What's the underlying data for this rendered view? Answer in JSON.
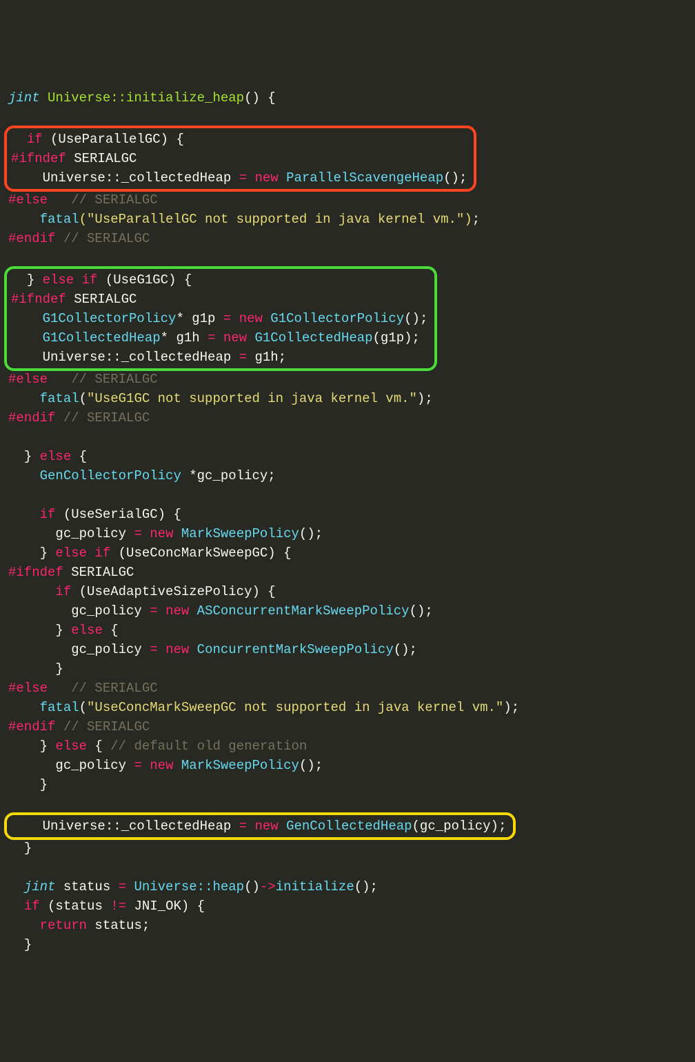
{
  "code": {
    "ret_type": "jint",
    "sig": "Universe::initialize_heap",
    "sig_tail": "() {",
    "if1": "if",
    "useParallel": "(UseParallelGC) {",
    "ifndef": "#ifndef",
    "serialgc": " SERIALGC",
    "assignPrefix": "Universe::_collectedHeap ",
    "eq": "= ",
    "new": "new",
    "psHeap": " ParallelScavengeHeap",
    "callTail0": "();",
    "else_cmt": "   // SERIALGC",
    "elsePre": "#else",
    "fatal": "fatal",
    "fatalParallel": "(\"UseParallelGC not supported in java kernel vm.\");",
    "endif": "#endif",
    "endif_cmt": " // SERIALGC",
    "closeBrace": "} ",
    "elseif": "else if",
    "useG1": " (UseG1GC) {",
    "g1p_type": "G1CollectorPolicy",
    "g1p_decl": "* g1p ",
    "g1p_ctor": " G1CollectorPolicy",
    "g1h_type": "G1CollectedHeap",
    "g1h_decl": "* g1h ",
    "g1h_ctor": " G1CollectedHeap",
    "g1h_arg": "(g1p);",
    "g1assign": "Universe::_collectedHeap ",
    "g1val": "g1h;",
    "fatalG1": "(\"UseG1GC not supported in java kernel vm.\");",
    "else": "else",
    "openBrace": " {",
    "gcp_type": "GenCollectorPolicy",
    "gcp_decl": " *gc_policy;",
    "useSerial": " (UseSerialGC) {",
    "gcp_assign": "gc_policy ",
    "markSweep": " MarkSweepPolicy",
    "useCMS": " (UseConcMarkSweepGC) {",
    "useAdaptive": " (UseAdaptiveSizePolicy) {",
    "ascms": " ASConcurrentMarkSweepPolicy",
    "cms": " ConcurrentMarkSweepPolicy",
    "fatalCMS": "(\"UseConcMarkSweepGC not supported in java kernel vm.\");",
    "defaultCmt": " // default old generation",
    "genHeap": " GenCollectedHeap",
    "genHeapArg": "(gc_policy);",
    "jint": "jint",
    "status_decl": " status ",
    "uniHeap": "Universe::heap",
    "heapCall": "()",
    "arrow": "->",
    "init": "initialize",
    "statusChk": " (status ",
    "neq": "!=",
    "jniok": " JNI_OK) {",
    "return": "return",
    "statusVar": " status;"
  },
  "highlights": {
    "red": "parallel-gc-block",
    "green": "g1-gc-block",
    "yellow": "gen-collected-heap-line"
  }
}
